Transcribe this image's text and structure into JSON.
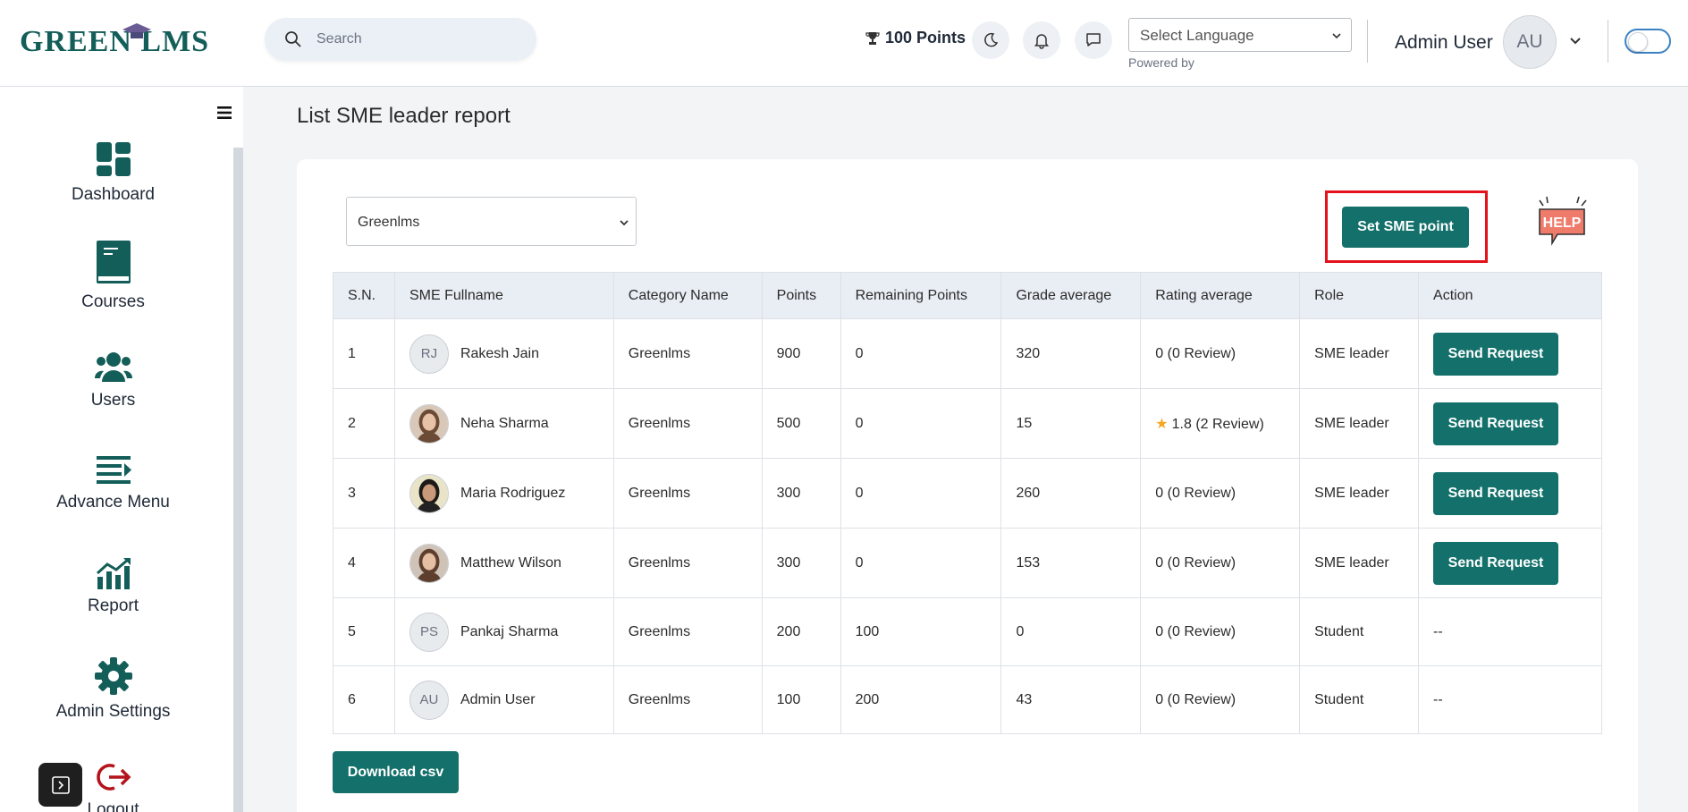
{
  "header": {
    "logo": "GREEN LMS",
    "search_placeholder": "Search",
    "points": "100 Points",
    "language_select": "Select Language",
    "powered_by": "Powered by",
    "user_name": "Admin User",
    "user_initials": "AU"
  },
  "sidebar": {
    "items": [
      {
        "label": "Dashboard",
        "icon": "dashboard-icon"
      },
      {
        "label": "Courses",
        "icon": "book-icon"
      },
      {
        "label": "Users",
        "icon": "users-icon"
      },
      {
        "label": "Advance Menu",
        "icon": "menu-list-icon"
      },
      {
        "label": "Report",
        "icon": "chart-icon"
      },
      {
        "label": "Admin Settings",
        "icon": "gear-icon"
      },
      {
        "label": "Logout",
        "icon": "logout-icon"
      }
    ]
  },
  "main": {
    "title": "List SME leader report",
    "org_select": "Greenlms",
    "set_sme_button": "Set SME point",
    "help_label": "HELP",
    "download_button": "Download csv",
    "columns": [
      "S.N.",
      "SME Fullname",
      "Category Name",
      "Points",
      "Remaining Points",
      "Grade average",
      "Rating average",
      "Role",
      "Action"
    ],
    "rows": [
      {
        "sn": "1",
        "name": "Rakesh Jain",
        "initials": "RJ",
        "photo": false,
        "category": "Greenlms",
        "points": "900",
        "remaining": "0",
        "grade": "320",
        "rating": "0 (0 Review)",
        "star": false,
        "role": "SME leader",
        "action": "Send Request"
      },
      {
        "sn": "2",
        "name": "Neha Sharma",
        "initials": "",
        "photo": true,
        "category": "Greenlms",
        "points": "500",
        "remaining": "0",
        "grade": "15",
        "rating": "1.8 (2 Review)",
        "star": true,
        "role": "SME leader",
        "action": "Send Request"
      },
      {
        "sn": "3",
        "name": "Maria Rodriguez",
        "initials": "",
        "photo": true,
        "category": "Greenlms",
        "points": "300",
        "remaining": "0",
        "grade": "260",
        "rating": "0 (0 Review)",
        "star": false,
        "role": "SME leader",
        "action": "Send Request"
      },
      {
        "sn": "4",
        "name": "Matthew Wilson",
        "initials": "",
        "photo": true,
        "category": "Greenlms",
        "points": "300",
        "remaining": "0",
        "grade": "153",
        "rating": "0 (0 Review)",
        "star": false,
        "role": "SME leader",
        "action": "Send Request"
      },
      {
        "sn": "5",
        "name": "Pankaj Sharma",
        "initials": "PS",
        "photo": false,
        "category": "Greenlms",
        "points": "200",
        "remaining": "100",
        "grade": "0",
        "rating": "0 (0 Review)",
        "star": false,
        "role": "Student",
        "action": "--"
      },
      {
        "sn": "6",
        "name": "Admin User",
        "initials": "AU",
        "photo": false,
        "category": "Greenlms",
        "points": "100",
        "remaining": "200",
        "grade": "43",
        "rating": "0 (0 Review)",
        "star": false,
        "role": "Student",
        "action": "--"
      }
    ]
  },
  "colors": {
    "accent": "#13706a",
    "highlight": "#e3121b",
    "star": "#f5a623"
  }
}
